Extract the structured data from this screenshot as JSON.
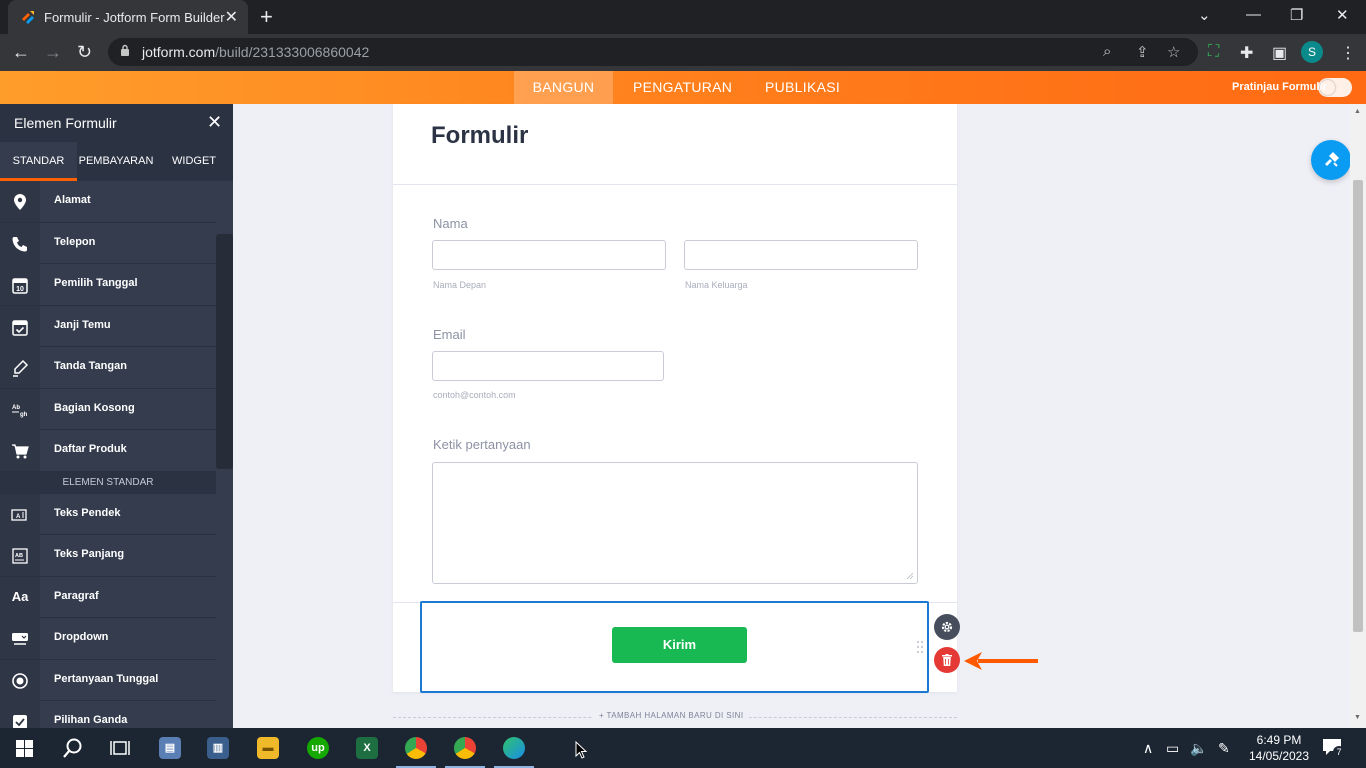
{
  "browser": {
    "tab_title": "Formulir - Jotform Form Builder",
    "url_domain": "jotform.com",
    "url_path": "/build/231333006860042",
    "profile_initial": "S"
  },
  "nav": {
    "tabs": [
      "BANGUN",
      "PENGATURAN",
      "PUBLIKASI"
    ],
    "active_tab": "BANGUN",
    "preview_label": "Pratinjau Formulir"
  },
  "sidebar": {
    "title": "Elemen Formulir",
    "tabs": [
      "STANDAR",
      "PEMBAYARAN",
      "WIDGET"
    ],
    "items": [
      {
        "label": "Alamat",
        "icon": "location-pin-icon"
      },
      {
        "label": "Telepon",
        "icon": "phone-icon"
      },
      {
        "label": "Pemilih Tanggal",
        "icon": "calendar-icon"
      },
      {
        "label": "Janji Temu",
        "icon": "calendar-check-icon"
      },
      {
        "label": "Tanda Tangan",
        "icon": "pen-icon"
      },
      {
        "label": "Bagian Kosong",
        "icon": "fill-blank-icon"
      },
      {
        "label": "Daftar Produk",
        "icon": "cart-icon"
      }
    ],
    "section_label": "ELEMEN STANDAR",
    "standard_items": [
      {
        "label": "Teks Pendek",
        "icon": "short-text-icon"
      },
      {
        "label": "Teks Panjang",
        "icon": "long-text-icon"
      },
      {
        "label": "Paragraf",
        "icon": "paragraph-icon"
      },
      {
        "label": "Dropdown",
        "icon": "dropdown-icon"
      },
      {
        "label": "Pertanyaan Tunggal",
        "icon": "radio-icon"
      },
      {
        "label": "Pilihan Ganda",
        "icon": "checkbox-icon"
      }
    ]
  },
  "form": {
    "title": "Formulir",
    "name_label": "Nama",
    "first_name_sub": "Nama Depan",
    "last_name_sub": "Nama Keluarga",
    "email_label": "Email",
    "email_sub": "contoh@contoh.com",
    "question_label": "Ketik pertanyaan",
    "submit_label": "Kirim",
    "add_page_label": "+ TAMBAH HALAMAN BARU DI SINI"
  },
  "taskbar": {
    "time": "6:49 PM",
    "date": "14/05/2023",
    "notification_count": "7"
  },
  "colors": {
    "brand_orange": "#ff7a1a",
    "submit_green": "#18b953",
    "selection_blue": "#1b79d3",
    "delete_red": "#e53935",
    "annotation_arrow": "#ff5a00"
  }
}
